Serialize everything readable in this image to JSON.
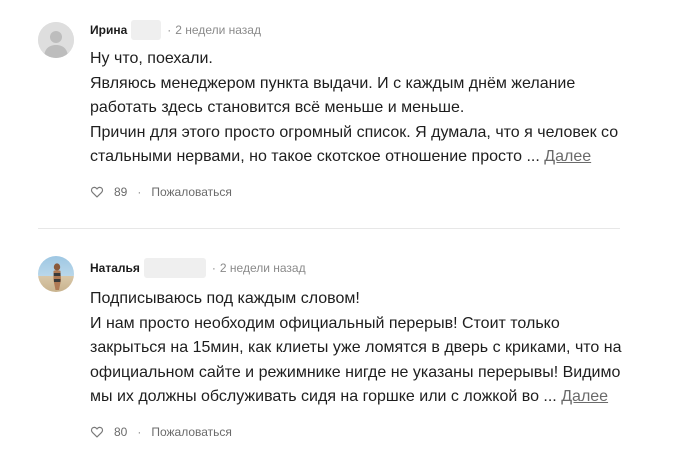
{
  "comments": [
    {
      "author": "Ирина",
      "time": "2 недели назад",
      "separator": "·",
      "lines": [
        "Ну что, поехали.",
        "Являюсь менеджером пункта выдачи. И с каждым днём желание",
        "работать здесь становится всё меньше и меньше.",
        "Причин для этого просто огромный список. Я думала, что я человек со",
        "стальными нервами, но такое скотское отношение просто ..."
      ],
      "more": "Далее",
      "likes": "89",
      "report": "Пожаловаться",
      "avatar_icon": "default-user-icon"
    },
    {
      "author": "Наталья",
      "time": "2 недели назад",
      "separator": "·",
      "lines": [
        "Подписываюсь под каждым словом!",
        "И нам просто необходим официальный перерыв! Стоит только",
        "закрыться на 15мин, как клиеты уже ломятся в дверь с криками, что на",
        "официальном сайте и режимнике нигде не указаны перерывы! Видимо",
        "мы их должны обслуживать сидя на горшке или с ложкой во ..."
      ],
      "more": "Далее",
      "likes": "80",
      "report": "Пожаловаться",
      "avatar_icon": "user-photo-icon"
    }
  ],
  "colors": {
    "text": "#1e1e1e",
    "meta": "#8a8a8a",
    "action": "#6b6b6b",
    "divider": "#e7e7e7",
    "avatar_default": "#dedede",
    "blur": "#efefef"
  }
}
